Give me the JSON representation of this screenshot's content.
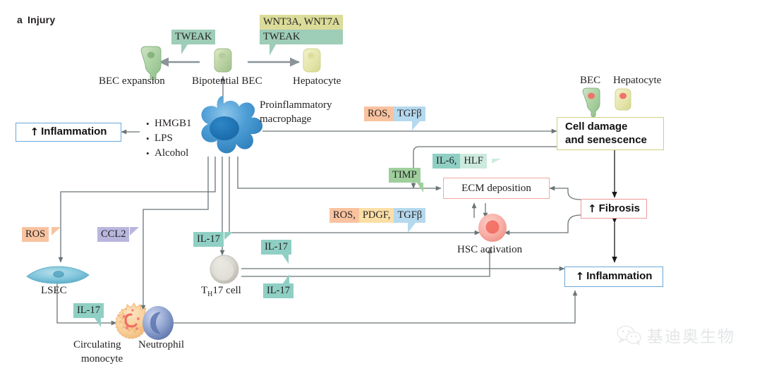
{
  "panel": {
    "letter": "a",
    "title": "Injury"
  },
  "cells": {
    "bec_expansion": {
      "label": "BEC expansion",
      "name": "bec-expansion-cell"
    },
    "bipotential_bec": {
      "label": "Bipotential BEC",
      "name": "bipotential-bec-cell"
    },
    "hepatocyte": {
      "label": "Hepatocyte",
      "name": "hepatocyte-cell"
    },
    "macrophage": {
      "label_line1": "Proinflammatory",
      "label_line2": "macrophage"
    },
    "lsec": {
      "label": "LSEC"
    },
    "monocyte": {
      "label_line1": "Circulating",
      "label_line2": "monocyte"
    },
    "neutrophil": {
      "label": "Neutrophil"
    },
    "th17": {
      "label_pre": "T",
      "label_sub": "H",
      "label_post": "17 cell"
    },
    "hsc": {
      "label": "HSC activation"
    }
  },
  "legend": {
    "bec": "BEC",
    "hepatocyte": "Hepatocyte"
  },
  "stimuli": {
    "title": "",
    "items": [
      "HMGB1",
      "LPS",
      "Alcohol"
    ]
  },
  "boxes": {
    "inflammation_left": {
      "arrow": "↑",
      "label": "Inflammation",
      "border": "#6aa8d8"
    },
    "cell_damage": {
      "line1": "Cell damage",
      "line2": "and senescence",
      "border": "#cfcf7e"
    },
    "fibrosis": {
      "arrow": "↑",
      "label": "Fibrosis",
      "border": "#f09a95"
    },
    "inflammation_right": {
      "arrow": "↑",
      "label": "Inflammation",
      "border": "#6aa8d8"
    },
    "ecm_deposition": {
      "label": "ECM deposition",
      "border": "#f4a7a1"
    }
  },
  "flags": {
    "tweak_left": {
      "segments": [
        {
          "text": "TWEAK",
          "color": "#9ecdb8"
        }
      ]
    },
    "wnt_tweak": {
      "segments_row1": [
        {
          "text": "WNT3A, WNT7A",
          "color": "#dcdc9a"
        }
      ],
      "segments_row2": [
        {
          "text": "TWEAK",
          "color": "#9ecdb8"
        }
      ]
    },
    "ros_tgfb": {
      "segments": [
        {
          "text": "ROS,",
          "color": "#f9c3a0"
        },
        {
          "text": "TGFβ",
          "color": "#b5d9ee"
        }
      ]
    },
    "il6_hlf": {
      "segments": [
        {
          "text": "IL-6,",
          "color": "#8fcfc4"
        },
        {
          "text": "HLF",
          "color": "#cdeade"
        }
      ]
    },
    "timp": {
      "segments": [
        {
          "text": "TIMP",
          "color": "#9ecf9c"
        }
      ]
    },
    "ros_pdgf_tgfb": {
      "segments": [
        {
          "text": "ROS,",
          "color": "#f9c3a0"
        },
        {
          "text": "PDGF,",
          "color": "#fbdfa7"
        },
        {
          "text": "TGFβ",
          "color": "#b5d9ee"
        }
      ]
    },
    "ros_lsec": {
      "segments": [
        {
          "text": "ROS",
          "color": "#f9c3a0"
        }
      ]
    },
    "ccl2": {
      "segments": [
        {
          "text": "CCL2",
          "color": "#b9b6de"
        }
      ]
    },
    "il17_macrophage": {
      "segments": [
        {
          "text": "IL-17",
          "color": "#8fcfc4"
        }
      ]
    },
    "il17_th17_top": {
      "segments": [
        {
          "text": "IL-17",
          "color": "#8fcfc4"
        }
      ]
    },
    "il17_th17_bottom": {
      "segments": [
        {
          "text": "IL-17",
          "color": "#8fcfc4"
        }
      ]
    },
    "il17_monocyte": {
      "segments": [
        {
          "text": "IL-17",
          "color": "#8fcfc4"
        }
      ]
    }
  },
  "watermark": {
    "text": "基迪奥生物",
    "icon": "wechat-icon"
  },
  "colors": {
    "connector": "#6b7478",
    "text": "#231f20",
    "blue_border": "#6aa8d8",
    "red_border": "#f09a95",
    "olive_border": "#cfcf7e",
    "pink_border": "#f4a7a1",
    "macrophage_blue": "#3d8fcd",
    "lsec_blue": "#76bcd4",
    "neutrophil_blue": "#7e93c6",
    "monocyte_orange": "#f6c98e",
    "th17_grey": "#d5d3cc",
    "hsc_pink": "#f6a8a0",
    "bec_green": "#9ec89b",
    "hepatocyte_yellow": "#e2e3a6"
  }
}
